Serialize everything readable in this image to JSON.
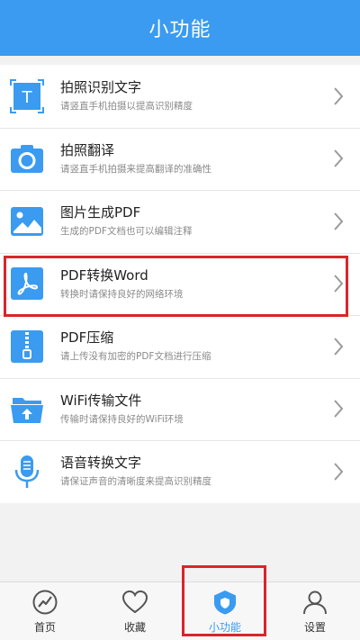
{
  "header": {
    "title": "小功能"
  },
  "colors": {
    "accent": "#3a9bf0",
    "highlight": "#d9242b"
  },
  "items": [
    {
      "icon": "text-recognition-icon",
      "title": "拍照识别文字",
      "subtitle": "请竖直手机拍摄以提高识别精度"
    },
    {
      "icon": "camera-icon",
      "title": "拍照翻译",
      "subtitle": "请竖直手机拍摄来提高翻译的准确性"
    },
    {
      "icon": "image-icon",
      "title": "图片生成PDF",
      "subtitle": "生成的PDF文档也可以编辑注释"
    },
    {
      "icon": "pdf-icon",
      "title": "PDF转换Word",
      "subtitle": "转换时请保持良好的网络环境"
    },
    {
      "icon": "zip-icon",
      "title": "PDF压缩",
      "subtitle": "请上传没有加密的PDF文档进行压缩"
    },
    {
      "icon": "folder-upload-icon",
      "title": "WiFi传输文件",
      "subtitle": "传输时请保持良好的WiFi环境"
    },
    {
      "icon": "microphone-icon",
      "title": "语音转换文字",
      "subtitle": "请保证声音的清晰度来提高识别精度"
    }
  ],
  "tabs": [
    {
      "icon": "home-icon",
      "label": "首页"
    },
    {
      "icon": "heart-icon",
      "label": "收藏"
    },
    {
      "icon": "shield-icon",
      "label": "小功能",
      "active": true
    },
    {
      "icon": "user-icon",
      "label": "设置"
    }
  ]
}
